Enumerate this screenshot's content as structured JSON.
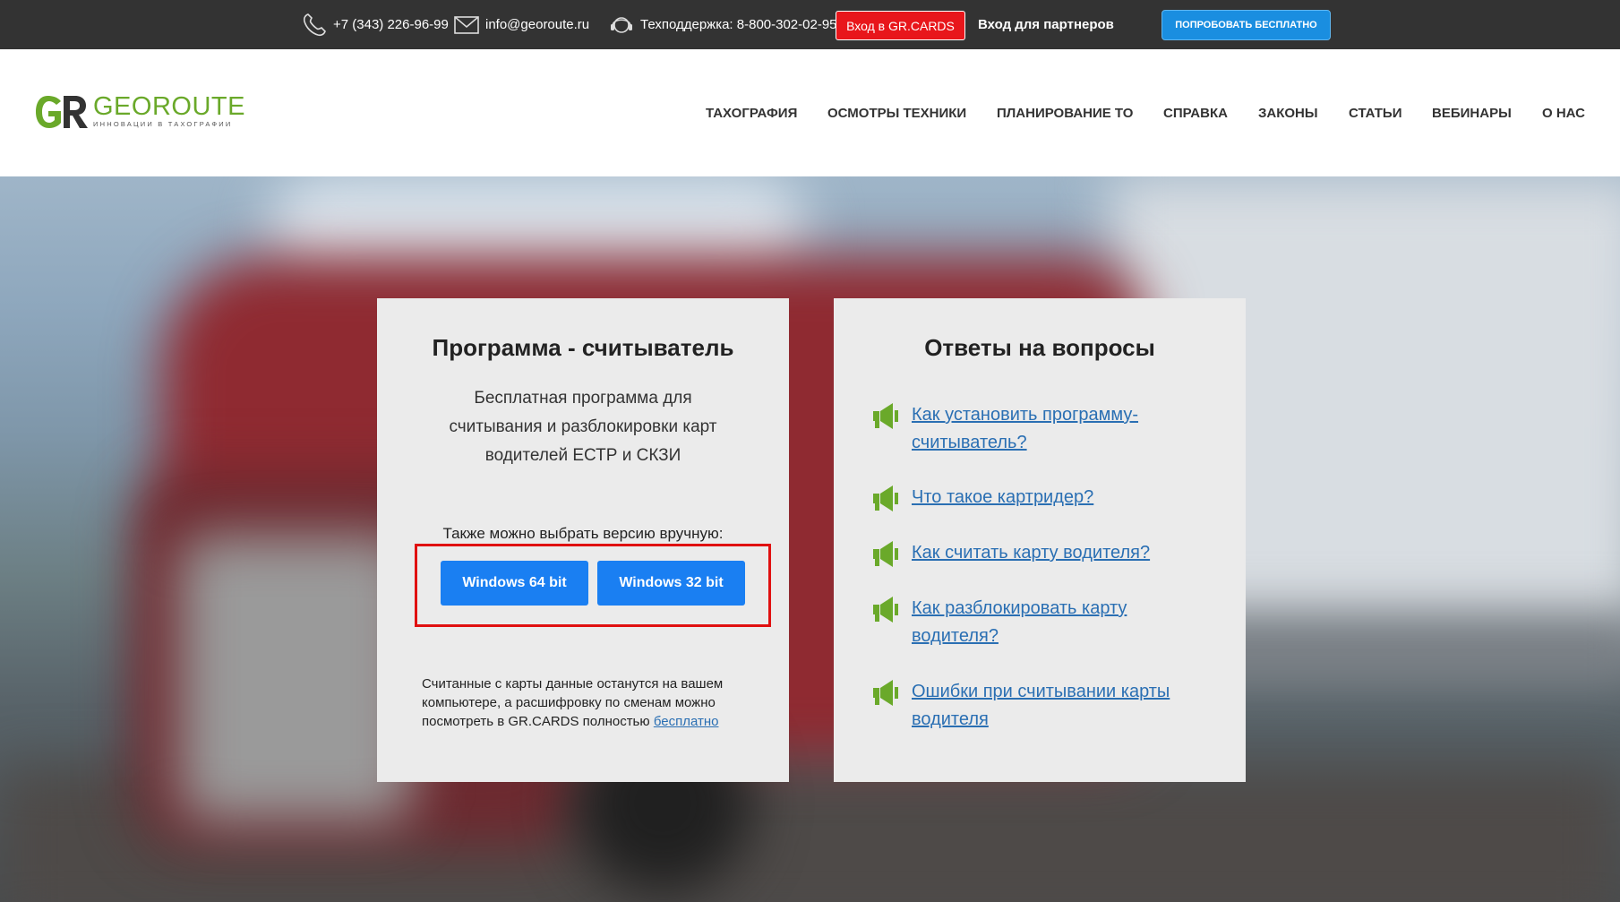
{
  "topbar": {
    "phone": "+7 (343) 226-96-99",
    "email": "info@georoute.ru",
    "support": "Техподдержка: 8-800-302-02-95",
    "grcards_button": "Вход в GR.CARDS",
    "partners_link": "Вход для партнеров",
    "try_button": "ПОПРОБОВАТЬ БЕСПЛАТНО"
  },
  "logo": {
    "name": "GEOROUTE",
    "tagline": "ИННОВАЦИИ В ТАХОГРАФИИ",
    "monogram": "GR"
  },
  "nav": {
    "items": [
      "ТАХОГРАФИЯ",
      "ОСМОТРЫ ТЕХНИКИ",
      "ПЛАНИРОВАНИЕ ТО",
      "СПРАВКА",
      "ЗАКОНЫ",
      "СТАТЬИ",
      "ВЕБИНАРЫ",
      "О НАС"
    ]
  },
  "reader_card": {
    "title": "Программа - считыватель",
    "description": "Бесплатная программа для считывания и разблокировки карт водителей ЕСТР и СКЗИ",
    "manual_choice": "Также можно выбрать версию вручную:",
    "btn_64": "Windows 64 bit",
    "btn_32": "Windows 32 bit",
    "footer_text": "Считанные с карты данные останутся на вашем компьютере, а расшифровку по сменам можно посмотреть в GR.CARDS полностью",
    "footer_link": "бесплатно"
  },
  "faq_card": {
    "title": "Ответы на вопросы",
    "items": [
      "Как установить программу-считыватель?",
      "Что такое картридер?",
      "Как считать карту водителя?",
      "Как разблокировать карту водителя?",
      "Ошибки при считывании карты водителя"
    ]
  },
  "colors": {
    "topbar_bg": "#333333",
    "grcards_red": "#e8161b",
    "try_blue": "#1a8ee0",
    "download_blue": "#1a7ff2",
    "link_blue": "#2a6fb3",
    "logo_green": "#6aa92a",
    "highlight_red": "#e01010"
  },
  "icons": [
    "phone-icon",
    "envelope-icon",
    "headset-icon",
    "megaphone-icon"
  ]
}
